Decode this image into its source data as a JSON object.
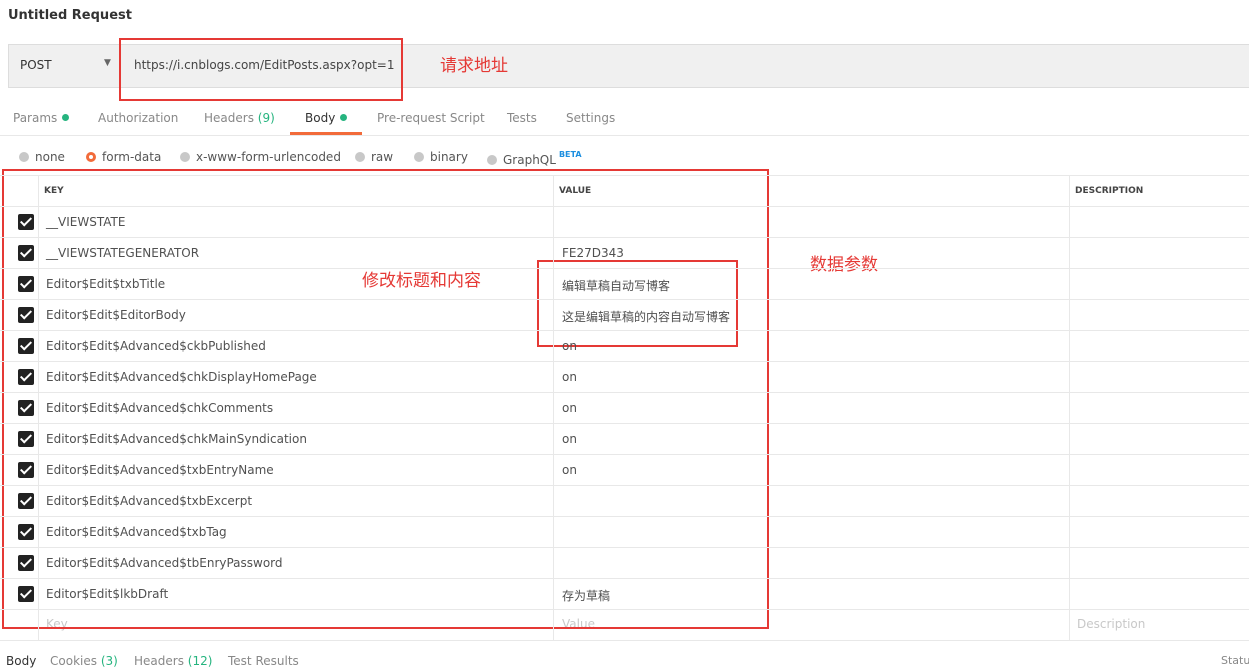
{
  "request": {
    "title": "Untitled Request",
    "method": "POST",
    "url": "https://i.cnblogs.com/EditPosts.aspx?opt=1"
  },
  "tabs": [
    {
      "label": "Params",
      "count": "",
      "dot": true
    },
    {
      "label": "Authorization",
      "count": "",
      "dot": false
    },
    {
      "label": "Headers",
      "count": "(9)",
      "dot": false
    },
    {
      "label": "Body",
      "count": "",
      "dot": true,
      "active": true
    },
    {
      "label": "Pre-request Script",
      "count": "",
      "dot": false
    },
    {
      "label": "Tests",
      "count": "",
      "dot": false
    },
    {
      "label": "Settings",
      "count": "",
      "dot": false
    }
  ],
  "body_modes": [
    "none",
    "form-data",
    "x-www-form-urlencoded",
    "raw",
    "binary",
    "GraphQL"
  ],
  "body_mode_selected": "form-data",
  "beta": "BETA",
  "table": {
    "headers": {
      "key": "KEY",
      "value": "VALUE",
      "description": "DESCRIPTION"
    },
    "rows": [
      {
        "key": "__VIEWSTATE",
        "value": ""
      },
      {
        "key": "__VIEWSTATEGENERATOR",
        "value": "FE27D343"
      },
      {
        "key": "Editor$Edit$txbTitle",
        "value": "编辑草稿自动写博客"
      },
      {
        "key": "Editor$Edit$EditorBody",
        "value": "这是编辑草稿的内容自动写博客"
      },
      {
        "key": "Editor$Edit$Advanced$ckbPublished",
        "value": "on"
      },
      {
        "key": "Editor$Edit$Advanced$chkDisplayHomePage",
        "value": "on"
      },
      {
        "key": "Editor$Edit$Advanced$chkComments",
        "value": "on"
      },
      {
        "key": "Editor$Edit$Advanced$chkMainSyndication",
        "value": "on"
      },
      {
        "key": "Editor$Edit$Advanced$txbEntryName",
        "value": "on"
      },
      {
        "key": "Editor$Edit$Advanced$txbExcerpt",
        "value": ""
      },
      {
        "key": "Editor$Edit$Advanced$txbTag",
        "value": ""
      },
      {
        "key": "Editor$Edit$Advanced$tbEnryPassword",
        "value": ""
      },
      {
        "key": "Editor$Edit$lkbDraft",
        "value": "存为草稿"
      }
    ],
    "placeholders": {
      "key": "Key",
      "value": "Value",
      "description": "Description"
    }
  },
  "annotations": {
    "url": "请求地址",
    "title_content": "修改标题和内容",
    "params": "数据参数"
  },
  "response_tabs": [
    {
      "label": "Body",
      "count": ""
    },
    {
      "label": "Cookies",
      "count": "(3)"
    },
    {
      "label": "Headers",
      "count": "(12)"
    },
    {
      "label": "Test Results",
      "count": ""
    }
  ],
  "status_label": "Status",
  "colors": {
    "accent": "#f26b3a",
    "green": "#26b47f",
    "annotation": "#e53935",
    "beta": "#1d8fe0"
  }
}
